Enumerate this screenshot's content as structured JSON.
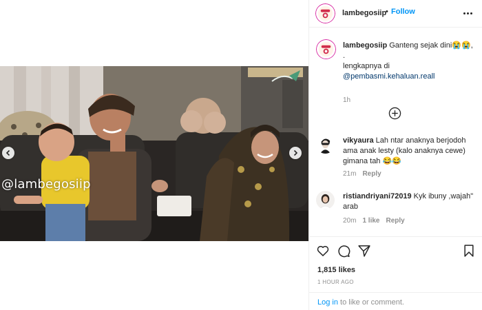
{
  "media": {
    "watermark": "@lambegosiip",
    "prev_icon": "chevron-left-icon",
    "next_icon": "chevron-right-icon"
  },
  "header": {
    "username": "lambegosiip",
    "dot": "•",
    "follow_label": "Follow",
    "more_icon": "more-horizontal-icon"
  },
  "caption": {
    "username": "lambegosiip",
    "line1": "Ganteng sejak dini😭😭,",
    "line2": ".",
    "line3": "lengkapnya di",
    "mention": "@pembasmi.kehaluan.reall",
    "time": "1h"
  },
  "load_more_icon": "plus-circle-icon",
  "comments": [
    {
      "username": "vikyaura",
      "text": "Lah ntar anaknya berjodoh ama anak lesty (kalo anaknya cewe) gimana tah 😂😂",
      "time": "21m",
      "likes": "",
      "reply_label": "Reply"
    },
    {
      "username": "ristiandriyani72019",
      "text": "Kyk ibuny ,wajah\" arab",
      "time": "20m",
      "likes": "1 like",
      "reply_label": "Reply"
    }
  ],
  "actions": {
    "icons": [
      "heart-icon",
      "comment-icon",
      "share-icon",
      "bookmark-icon"
    ],
    "likes": "1,815 likes",
    "posted": "1 HOUR AGO"
  },
  "login": {
    "link": "Log in",
    "rest": "to like or comment."
  },
  "colors": {
    "accent": "#0095f6",
    "mention": "#00376b",
    "muted": "#8e8e8e",
    "text": "#262626"
  }
}
